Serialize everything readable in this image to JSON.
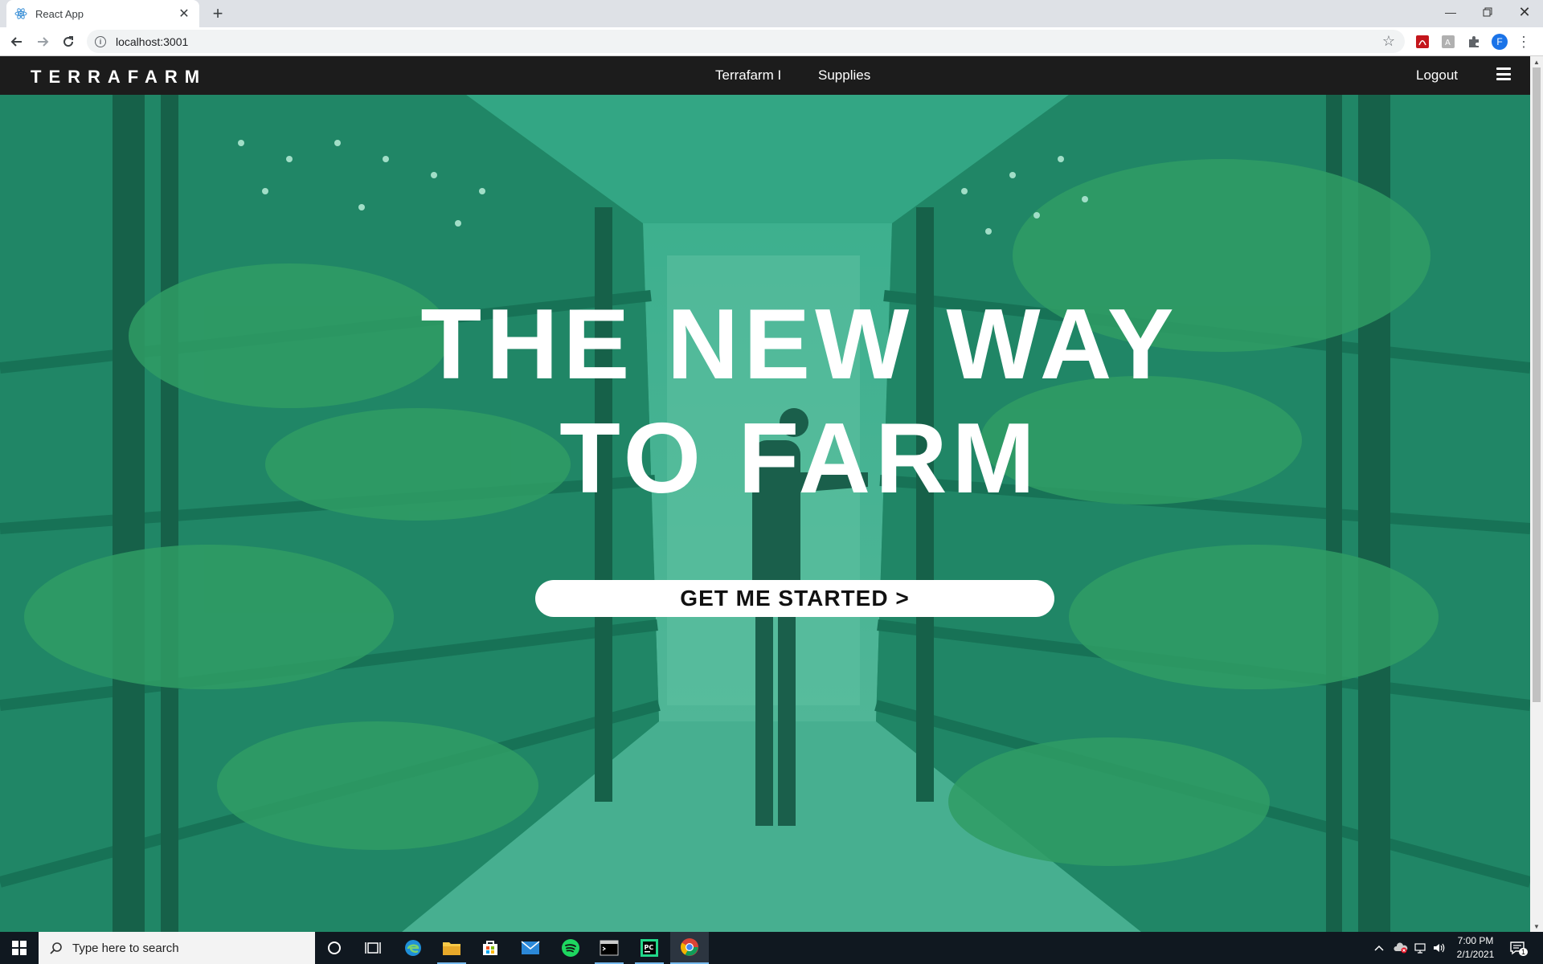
{
  "browser": {
    "tab_title": "React App",
    "url": "localhost:3001",
    "profile_initial": "F"
  },
  "app": {
    "logo": "TERRAFARM",
    "nav_links": [
      "Terrafarm I",
      "Supplies"
    ],
    "logout": "Logout",
    "hero_line1": "THE NEW WAY",
    "hero_line2": "TO FARM",
    "cta": "GET ME STARTED >"
  },
  "taskbar": {
    "search_placeholder": "Type here to search",
    "time": "7:00 PM",
    "date": "2/1/2021",
    "notification_count": "1"
  },
  "colors": {
    "nav_bg": "#1c1c1c",
    "hero_tint": "#2a8c6e",
    "taskbar_bg": "#101820"
  }
}
